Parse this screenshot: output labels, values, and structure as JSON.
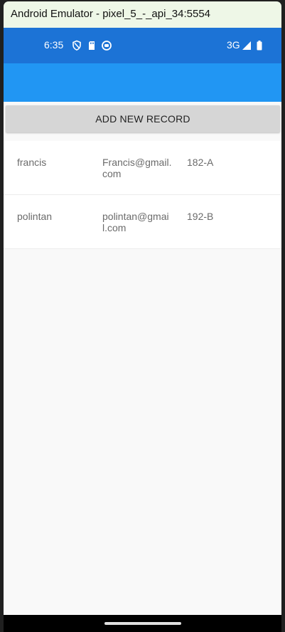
{
  "window": {
    "title": "Android Emulator - pixel_5_-_api_34:5554"
  },
  "statusbar": {
    "time": "6:35",
    "network": "3G"
  },
  "actions": {
    "add_label": "ADD NEW RECORD"
  },
  "records": [
    {
      "name": "francis",
      "email": "Francis@gmail.com",
      "code": "182-A"
    },
    {
      "name": "polintan",
      "email": "polintan@gmail.com",
      "code": "192-B"
    }
  ],
  "colors": {
    "statusbar": "#1c73d6",
    "toolbar": "#2196f3",
    "button": "#d6d6d6",
    "background": "#f9f9f9"
  },
  "icons": [
    "shield-icon",
    "sd-card-icon",
    "sync-icon",
    "signal-icon",
    "battery-icon"
  ]
}
